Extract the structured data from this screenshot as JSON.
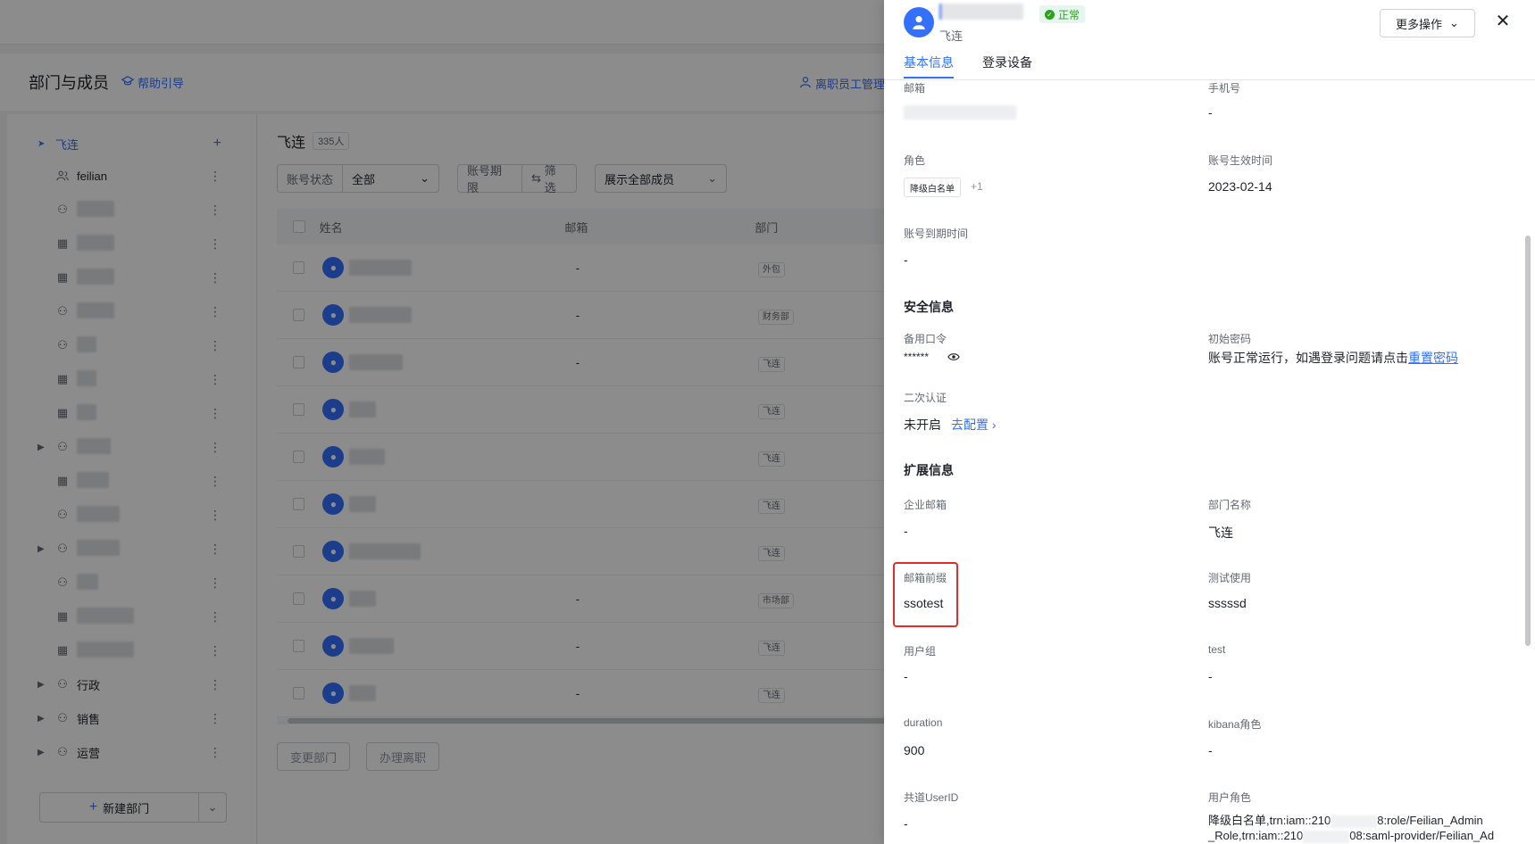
{
  "page": {
    "title": "部门与成员",
    "help_link": "帮助引导",
    "leave_link": "离职员工管理"
  },
  "tree": {
    "root_label": "飞连",
    "first_child": "feilian",
    "named_children": [
      "行政",
      "销售",
      "运营"
    ],
    "new_dept_label": "新建部门"
  },
  "content": {
    "dept_title": "飞连",
    "member_count": "335人",
    "filters": {
      "status_label": "账号状态",
      "status_value": "全部",
      "period_label": "账号期限",
      "filter_label": "筛选",
      "show_all": "展示全部成员"
    },
    "columns": [
      "姓名",
      "邮箱",
      "部门"
    ],
    "rows": [
      {
        "email": "-",
        "dept": "外包"
      },
      {
        "email": "-",
        "dept": "财务部"
      },
      {
        "email": "-",
        "dept": "飞连"
      },
      {
        "email": "",
        "dept": "飞连"
      },
      {
        "email": "",
        "dept": "飞连"
      },
      {
        "email": "",
        "dept": "飞连"
      },
      {
        "email": "",
        "dept": "飞连"
      },
      {
        "email": "-",
        "dept": "市场部"
      },
      {
        "email": "-",
        "dept": "飞连"
      },
      {
        "email": "-",
        "dept": "飞连"
      }
    ],
    "bottom_buttons": [
      "变更部门",
      "办理离职"
    ]
  },
  "drawer": {
    "status": "正常",
    "org": "飞连",
    "more_actions": "更多操作",
    "tabs": [
      "基本信息",
      "登录设备"
    ],
    "fields": {
      "email_label": "邮箱",
      "phone_label": "手机号",
      "phone_value": "-",
      "role_label": "角色",
      "role_tag": "降级白名单",
      "role_more": "+1",
      "effective_label": "账号生效时间",
      "effective_value": "2023-02-14",
      "expire_label": "账号到期时间",
      "expire_value": "-"
    },
    "security": {
      "title": "安全信息",
      "backup_label": "备用口令",
      "backup_value": "******",
      "init_pwd_label": "初始密码",
      "init_pwd_text": "账号正常运行，如遇登录问题请点击",
      "reset_link": "重置密码",
      "twofa_label": "二次认证",
      "twofa_value": "未开启",
      "config_link": "去配置"
    },
    "extended": {
      "title": "扩展信息",
      "corp_email_label": "企业邮箱",
      "corp_email_value": "-",
      "dept_name_label": "部门名称",
      "dept_name_value": "飞连",
      "email_prefix_label": "邮箱前缀",
      "email_prefix_value": "ssotest",
      "test_use_label": "测试使用",
      "test_use_value": "sssssd",
      "user_group_label": "用户组",
      "user_group_value": "-",
      "test_label": "test",
      "test_value": "-",
      "duration_label": "duration",
      "duration_value": "900",
      "kibana_label": "kibana角色",
      "kibana_value": "-",
      "shared_uid_label": "共道UserID",
      "shared_uid_value": "-",
      "user_role_label": "用户角色",
      "user_role_line1_a": "降级白名单,trn:iam::210",
      "user_role_line1_b": "8:role/Feilian_Admin",
      "user_role_line2_a": "_Role,trn:iam::210",
      "user_role_line2_b": "08:saml-provider/Feilian_Ad"
    }
  },
  "colors": {
    "accent": "#3370ff",
    "success": "#2ea121",
    "highlight": "#e22b2b"
  }
}
